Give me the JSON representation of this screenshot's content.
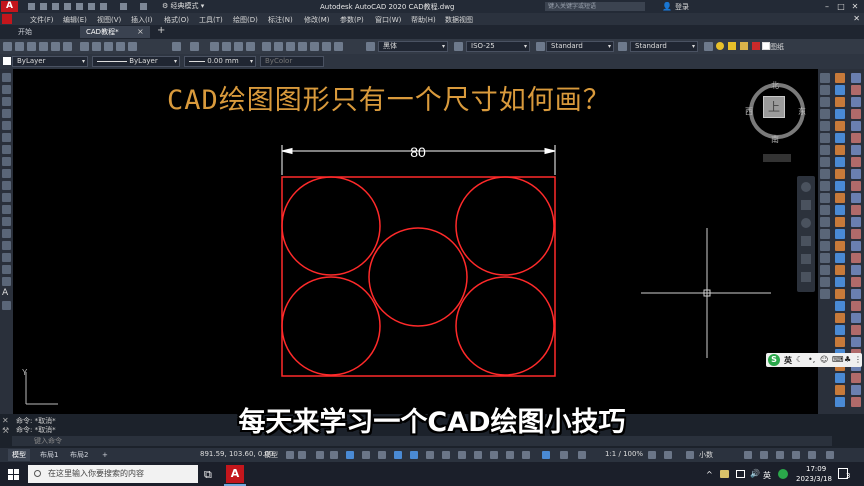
{
  "app": {
    "logo_letter": "A",
    "workspace": "经典模式",
    "window_title": "Autodesk AutoCAD 2020    CAD教程.dwg",
    "search_placeholder": "键入关键字或短语",
    "login": "登录"
  },
  "menu": [
    "文件(F)",
    "编辑(E)",
    "视图(V)",
    "插入(I)",
    "格式(O)",
    "工具(T)",
    "绘图(D)",
    "标注(N)",
    "修改(M)",
    "参数(P)",
    "窗口(W)",
    "帮助(H)",
    "数据视图"
  ],
  "tabs": {
    "start": "开始",
    "current": "CAD教程*",
    "close": "×",
    "add": "+"
  },
  "toolbar1": {
    "text_style": "黑体",
    "dim_style": "ISO-25",
    "table_style": "Standard",
    "multileader_style": "Standard",
    "layer": "图纸"
  },
  "toolbar2": {
    "color": "ByLayer",
    "linetype": "ByLayer",
    "lineweight": "0.00 mm",
    "plot_style": "ByColor"
  },
  "headline": "CAD绘图图形只有一个尺寸如何画？",
  "dimension": {
    "value": "80"
  },
  "drawing": {
    "stroke_color": "#ff2a2a",
    "circle_count": 5
  },
  "viewcube": {
    "face": "上",
    "north": "北",
    "south": "南",
    "west": "西",
    "east": "东"
  },
  "ucs": {
    "y_label": "Y"
  },
  "ime": {
    "s": "S",
    "lang": "英"
  },
  "command": {
    "history": [
      "命令: *取消*",
      "命令: *取消*"
    ],
    "placeholder": "键入命令"
  },
  "caption": "每天来学习一个CAD绘图小技巧",
  "status": {
    "layouts": [
      "模型",
      "布局1",
      "布局2"
    ],
    "add_layout": "+",
    "coords": "891.59, 103.60, 0.00",
    "model": "模型",
    "scale": "1:1 / 100%",
    "units": "小数"
  },
  "taskbar": {
    "search_placeholder": "在这里输入你要搜索的内容",
    "autocad_letter": "A",
    "lang": "英",
    "time": "17:09",
    "date": "2023/3/18",
    "notify": "3"
  }
}
